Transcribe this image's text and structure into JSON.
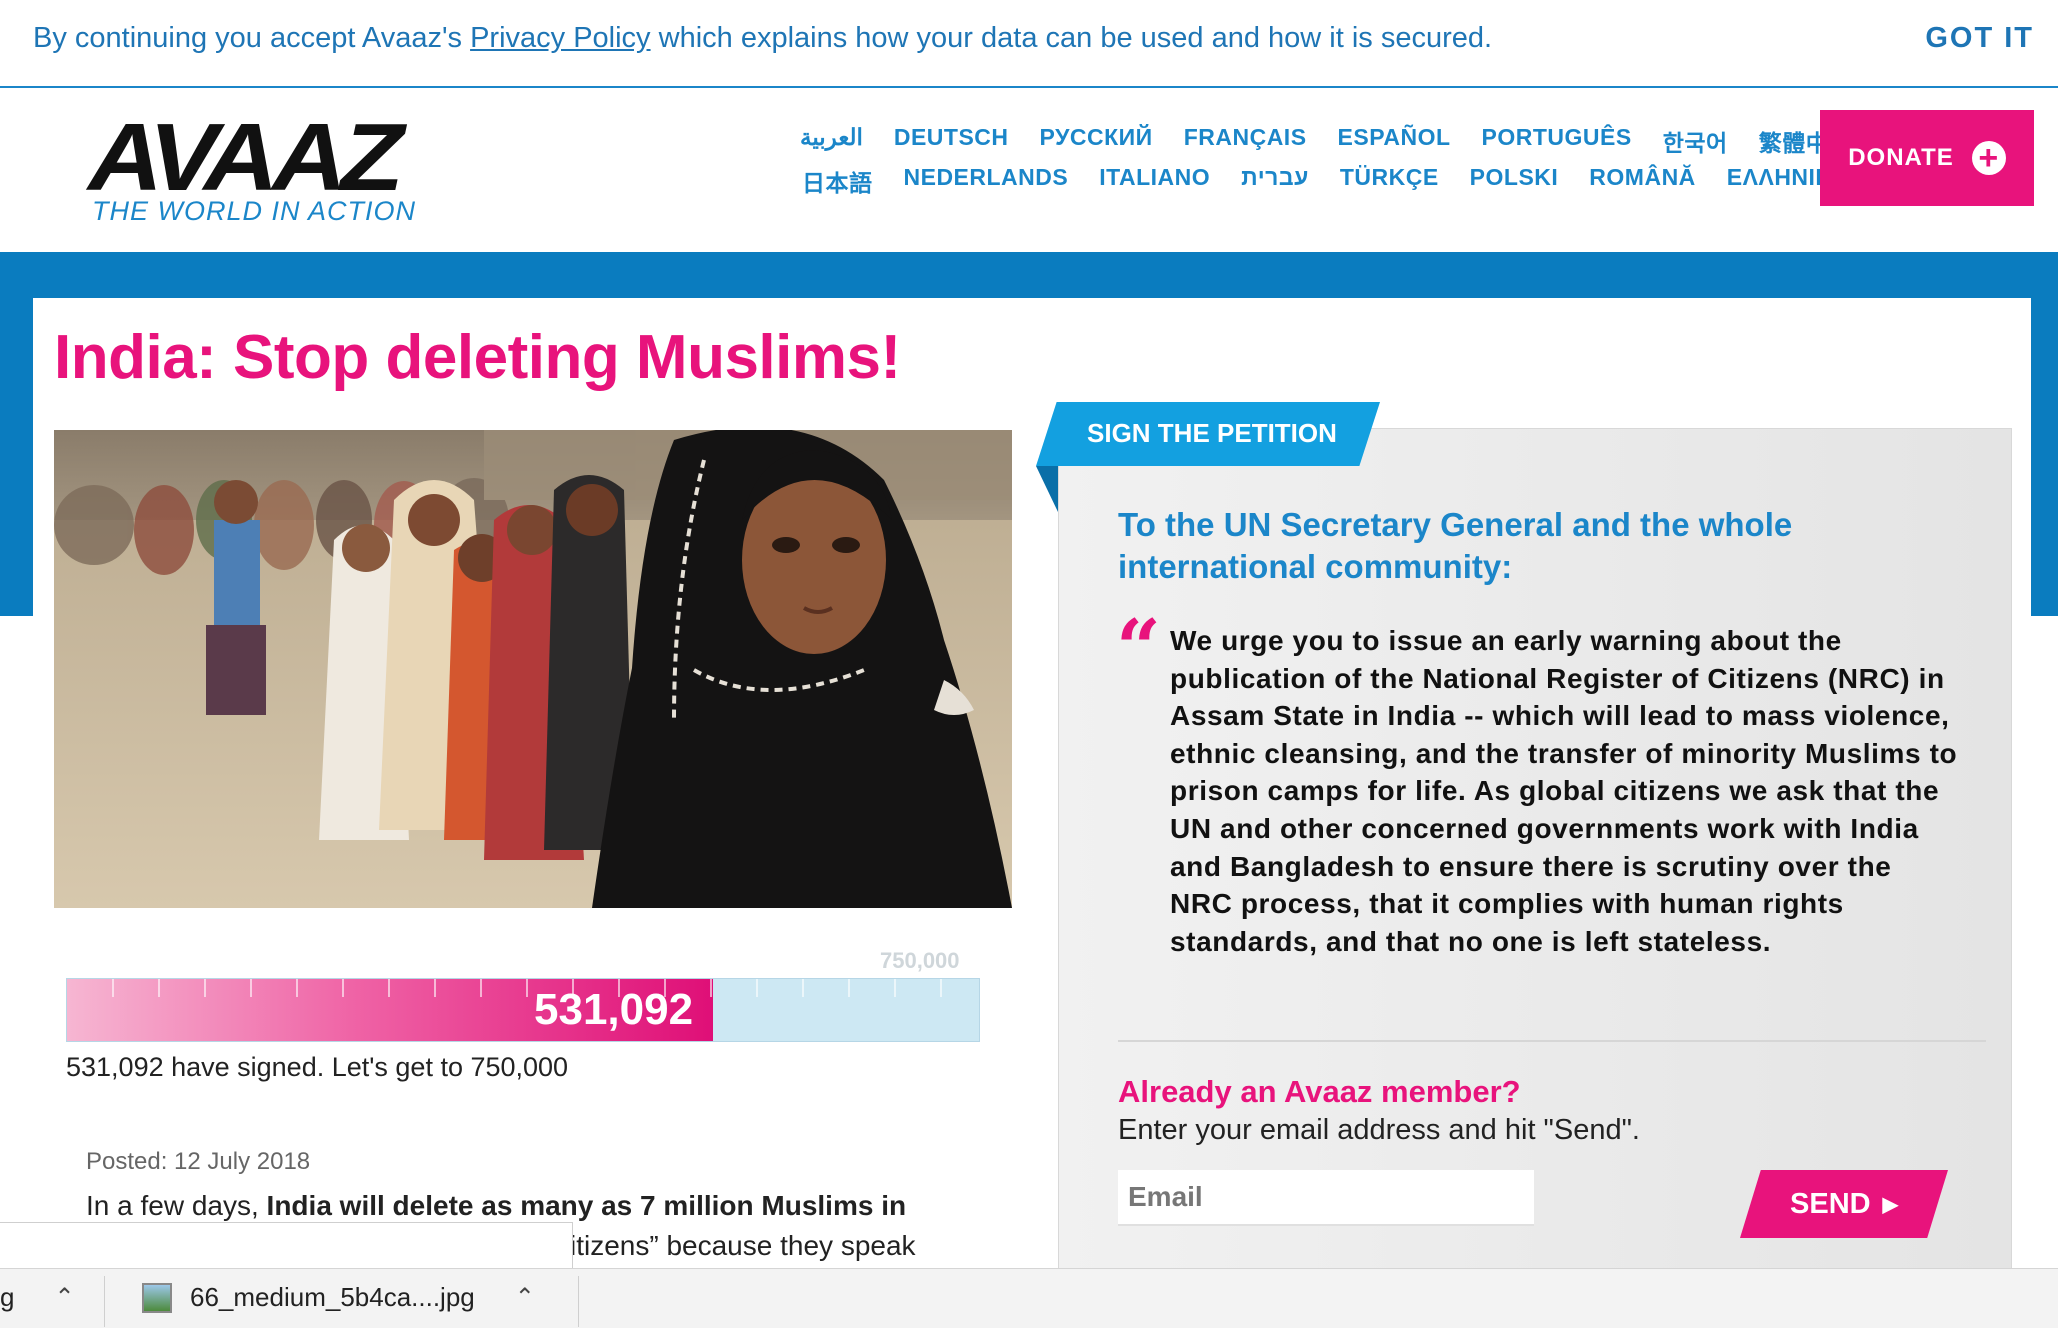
{
  "cookie": {
    "prefix": "By continuing you accept Avaaz's ",
    "link": "Privacy Policy",
    "suffix": " which explains how your data can be used and how it is secured.",
    "button": "GOT IT"
  },
  "header": {
    "logo": "AVAAZ",
    "tagline": "THE WORLD IN ACTION",
    "languages_row1": [
      "العربية",
      "DEUTSCH",
      "РУССКИЙ",
      "FRANÇAIS",
      "ESPAÑOL",
      "PORTUGUÊS",
      "한국어",
      "繁體中文"
    ],
    "languages_row2": [
      "日本語",
      "NEDERLANDS",
      "ITALIANO",
      "עברית",
      "TÜRKÇE",
      "POLSKI",
      "ROMÂNĂ",
      "ΕΛΛΗΝΙΚΑ"
    ],
    "donate": "DONATE"
  },
  "campaign": {
    "title": "India: Stop deleting Muslims!",
    "goal": "750,000",
    "count": "531,092",
    "progress_fraction": 0.708,
    "signed_text": "531,092 have signed. Let's get to 750,000",
    "posted": "Posted: 12 July 2018",
    "body_prefix": "In a few days, ",
    "body_bold": "India will delete as many as 7 million Muslims in",
    "body_line2": "itizens” because they speak"
  },
  "petition": {
    "tab": "SIGN THE PETITION",
    "to": "To the UN Secretary General and the whole international community:",
    "text": "We urge you to issue an early warning about the publication of the National Register of Citizens (NRC) in Assam State in India -- which will lead to mass violence, ethnic cleansing, and the transfer of minority Muslims to prison camps for life. As global citizens we ask that the UN and other concerned governments work with India and Bangladesh to ensure there is scrutiny over the NRC process, that it complies with human rights standards, and that no one is left stateless.",
    "member_head": "Already an Avaaz member?",
    "member_sub": "Enter your email address and hit \"Send\".",
    "email_placeholder": "Email",
    "send": "SEND"
  },
  "downloads": {
    "item1": "g",
    "item2": "66_medium_5b4ca....jpg"
  },
  "colors": {
    "brand_pink": "#e8137c",
    "brand_blue": "#1b86c9",
    "band_blue": "#0a7cbf"
  }
}
